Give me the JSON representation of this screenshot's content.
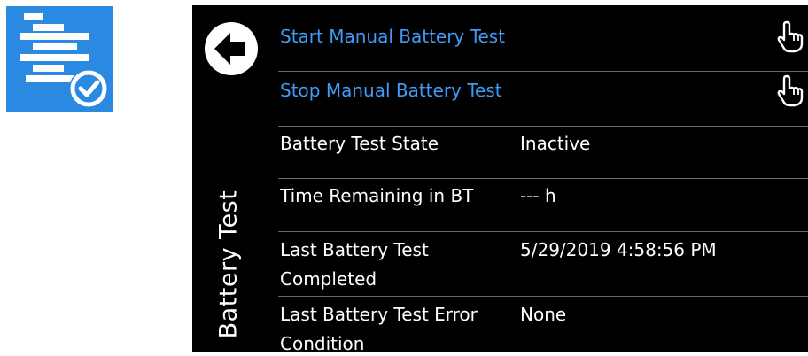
{
  "app_icon": {
    "icon": "task-list-check-icon",
    "accent": "#2a8ae2"
  },
  "screen": {
    "title": "Battery Test",
    "back_icon": "back-arrow-icon",
    "actions": [
      {
        "label": "Start Manual Battery Test",
        "icon": "hand-pointer-icon"
      },
      {
        "label": "Stop Manual Battery Test",
        "icon": "hand-pointer-icon"
      }
    ],
    "rows": [
      {
        "label": "Battery Test State",
        "value": "Inactive"
      },
      {
        "label": "Time Remaining in BT",
        "value": "--- h"
      },
      {
        "label_line1": "Last Battery Test",
        "label_line2": "Completed",
        "value": "5/29/2019 4:58:56 PM"
      },
      {
        "label_line1": "Last Battery Test Error",
        "label_line2": "Condition",
        "value": "None"
      }
    ],
    "colors": {
      "link": "#3f9bf5",
      "background": "#000000",
      "divider": "#6a6a6a"
    }
  }
}
